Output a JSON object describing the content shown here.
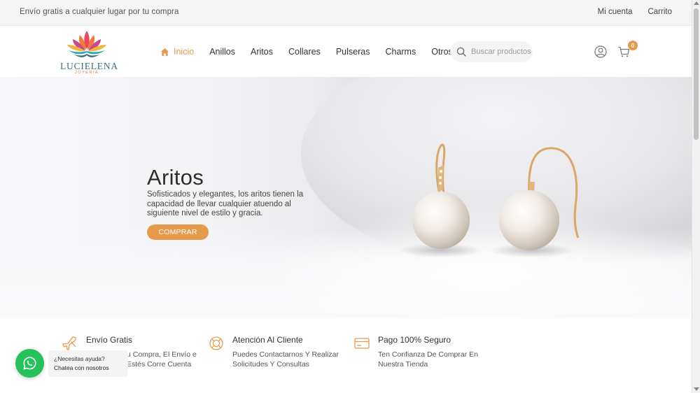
{
  "topbar": {
    "promo": "Envío gratis a cualquier lugar por tu compra",
    "my_account": "Mi cuenta",
    "cart": "Carrito"
  },
  "brand": {
    "name": "LUCIELENA",
    "tagline": "JOYERIA"
  },
  "nav": {
    "items": [
      {
        "label": "Inicio",
        "icon": "home-icon",
        "active": true
      },
      {
        "label": "Anillos"
      },
      {
        "label": "Aritos"
      },
      {
        "label": "Collares"
      },
      {
        "label": "Pulseras"
      },
      {
        "label": "Charms"
      },
      {
        "label": "Otros"
      }
    ]
  },
  "search": {
    "placeholder": "Buscar productos",
    "icon": "search-icon"
  },
  "header_icons": {
    "account_icon": "user-icon",
    "cart_icon": "cart-icon",
    "cart_count": "0"
  },
  "hero": {
    "title": "Aritos",
    "description": "Sofisticados y elegantes, los aritos tienen la capacidad de llevar cualquier atuendo al siguiente nivel de estilo y gracia.",
    "cta": "COMPRAR"
  },
  "features": [
    {
      "icon": "plane-icon",
      "title": "Envío Gratis",
      "text": "u Compra, El Envío e Estés Corre Cuenta"
    },
    {
      "icon": "lifebuoy-icon",
      "title": "Atención Al Cliente",
      "text": "Puedes Contactarnos Y Realizar Solicitudes Y Consultas"
    },
    {
      "icon": "credit-card-icon",
      "title": "Pago 100% Seguro",
      "text": "Ten Confianza De Comprar En Nuestra Tienda"
    }
  ],
  "whatsapp": {
    "line1": "¿Necesitas ayuda?",
    "line2": "Chatea con nosotros",
    "icon": "whatsapp-icon"
  },
  "colors": {
    "accent": "#e89a4c",
    "whatsapp": "#25c15a",
    "brand_blue": "#3a6f84"
  }
}
